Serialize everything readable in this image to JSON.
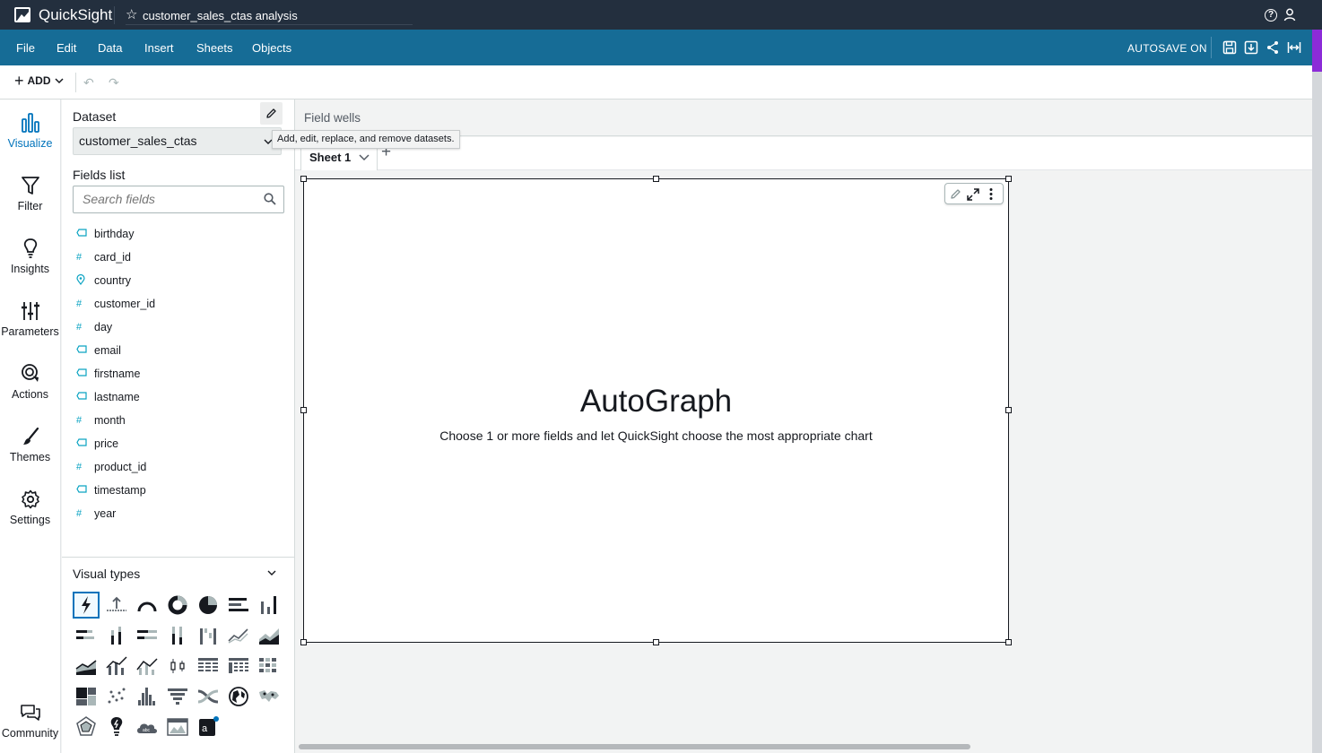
{
  "titlebar": {
    "app_name": "QuickSight",
    "analysis_title": "customer_sales_ctas analysis"
  },
  "menubar": {
    "items": [
      "File",
      "Edit",
      "Data",
      "Insert",
      "Sheets",
      "Objects"
    ],
    "autosave": "AUTOSAVE ON"
  },
  "toolbar": {
    "add_label": "ADD"
  },
  "leftnav": {
    "items": [
      "Visualize",
      "Filter",
      "Insights",
      "Parameters",
      "Actions",
      "Themes",
      "Settings"
    ],
    "community": "Community"
  },
  "dataset": {
    "label": "Dataset",
    "selected": "customer_sales_ctas",
    "tooltip": "Add, edit, replace, and remove datasets."
  },
  "fields": {
    "label": "Fields list",
    "search_placeholder": "Search fields",
    "items": [
      {
        "name": "birthday",
        "type": "dimension"
      },
      {
        "name": "card_id",
        "type": "measure"
      },
      {
        "name": "country",
        "type": "geo"
      },
      {
        "name": "customer_id",
        "type": "measure"
      },
      {
        "name": "day",
        "type": "measure"
      },
      {
        "name": "email",
        "type": "dimension"
      },
      {
        "name": "firstname",
        "type": "dimension"
      },
      {
        "name": "lastname",
        "type": "dimension"
      },
      {
        "name": "month",
        "type": "measure"
      },
      {
        "name": "price",
        "type": "dimension"
      },
      {
        "name": "product_id",
        "type": "measure"
      },
      {
        "name": "timestamp",
        "type": "dimension"
      },
      {
        "name": "year",
        "type": "measure"
      }
    ]
  },
  "visual_types": {
    "label": "Visual types",
    "selected": "autograph"
  },
  "main": {
    "field_wells": "Field wells",
    "sheet_tab": "Sheet 1",
    "visual_title": "AutoGraph",
    "visual_description": "Choose 1 or more fields and let QuickSight choose the most appropriate chart"
  },
  "colors": {
    "titlebar": "#232f3e",
    "menubar": "#166c96",
    "accent": "#0073bb",
    "field_icon": "#0aa3c2"
  }
}
